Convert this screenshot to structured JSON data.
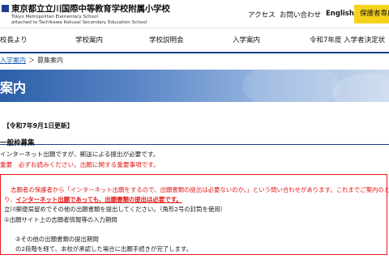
{
  "header": {
    "school_name_ja": "東京都立立川国際中等教育学校附属小学校",
    "school_name_en_1": "Tokyo Metropolitan Elementary School",
    "school_name_en_2": "attached to Tachikawa Kokusai Secondary Education School",
    "util_links": {
      "access": "アクセス",
      "contact": "お問い合わせ",
      "english": "English"
    },
    "guardian_button": "保護者専用",
    "accent_color": "#1e3f8a",
    "button_color": "#f5d31a"
  },
  "nav": {
    "items": [
      "校長より",
      "学校案内",
      "学校説明会",
      "入学案内",
      "令和7年度 入学者決定状"
    ]
  },
  "breadcrumb": {
    "link": "入学案内",
    "separator": "＞",
    "current": "募集案内"
  },
  "page": {
    "title": "案内"
  },
  "content": {
    "update_note": "【令和7年9月1日更新】",
    "section_title": "一般枠募集",
    "line1": "インターネット出願ですが、郵送による提出が必要です。",
    "line2": "重要　必ずお読みください。出願に関する重要事項です。",
    "notice": {
      "line1": "志願者の保護者から「インターネット出願をするので、出願書類の提出は必要ないのか。」という問い合わせがあります。これまでご案内のとお",
      "line2_pre": "り、",
      "line2_bold": "インターネット出願であっても、出願書類の提出は必要です。",
      "line3": "立川郵便局留めでその他の出願書類を提出してください。（角形2号の封筒を使用）",
      "line4": "①出願サイト上の志願者情報等の入力期間",
      "line5": "②その他の出願書類の提出期間",
      "line6": "の2段階を経て、本校が承認した場合に出願手続きが完了します。",
      "line7": ""
    },
    "warning_color": "#e01a1a"
  }
}
